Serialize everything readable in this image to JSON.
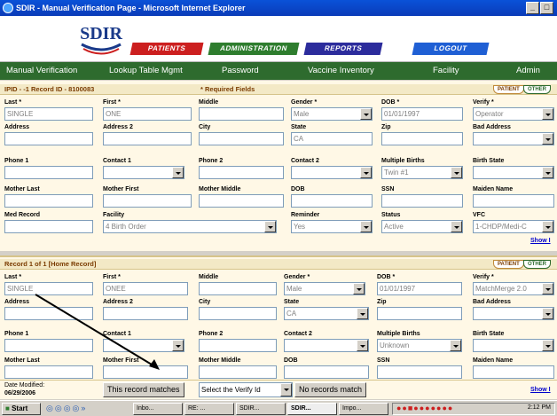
{
  "window": {
    "title": "SDIR - Manual Verification Page - Microsoft Internet Explorer",
    "min": "_",
    "restore": "□"
  },
  "banner": {
    "logo": "SDIR",
    "tabs": [
      "PATIENTS",
      "ADMINISTRATION",
      "REPORTS",
      "LOGOUT"
    ]
  },
  "menu": [
    "Manual Verification",
    "Lookup Table Mgmt",
    "Password",
    "Vaccine Inventory",
    "Facility",
    "Admin"
  ],
  "colors": {
    "tab_patients": "#cc1f1f",
    "tab_admin": "#2e7d2e",
    "tab_reports": "#2c2c9c",
    "tab_logout": "#1f5fd4",
    "menubar": "#2e6b2e"
  },
  "section1": {
    "header": "IPID - -1 Record ID - 8100083",
    "required": "* Required Fields",
    "pills": [
      "PATIENT",
      "OTHER"
    ],
    "labels": {
      "last": "Last *",
      "first": "First *",
      "middle": "Middle",
      "gender": "Gender *",
      "dob": "DOB *",
      "verify": "Verify *",
      "address": "Address",
      "address2": "Address 2",
      "city": "City",
      "state": "State",
      "zip": "Zip",
      "bad_address": "Bad Address",
      "phone1": "Phone 1",
      "contact1": "Contact 1",
      "phone2": "Phone 2",
      "contact2": "Contact 2",
      "multiple_births": "Multiple Births",
      "birth_state": "Birth State",
      "mother_last": "Mother Last",
      "mother_first": "Mother First",
      "mother_middle": "Mother Middle",
      "dob2": "DOB",
      "ssn": "SSN",
      "maiden": "Maiden Name",
      "med_record": "Med Record",
      "facility": "Facility",
      "reminder": "Reminder",
      "status": "Status",
      "vfc": "VFC"
    },
    "values": {
      "last": "SINGLE",
      "first": "ONE",
      "gender": "Male",
      "dob": "01/01/1997",
      "verify": "Operator",
      "state": "CA",
      "multiple_births": "Twin #1",
      "facility": "4 Birth Order",
      "reminder": "Yes",
      "status": "Active",
      "vfc": "1-CHDP/Medi-C"
    },
    "show": "Show I"
  },
  "section2": {
    "header": "Record 1 of 1 [Home Record]",
    "pills": [
      "PATIENT",
      "OTHER"
    ],
    "labels": {
      "last": "Last *",
      "first": "First *",
      "middle": "Middle",
      "gender": "Gender *",
      "dob": "DOB *",
      "verify": "Verify *",
      "address": "Address",
      "address2": "Address 2",
      "city": "City",
      "state": "State",
      "zip": "Zip",
      "bad_address": "Bad Address",
      "phone1": "Phone 1",
      "contact1": "Contact 1",
      "phone2": "Phone 2",
      "contact2": "Contact 2",
      "multiple_births": "Multiple Births",
      "birth_state": "Birth State",
      "mother_last": "Mother Last",
      "mother_first": "Mother First",
      "mother_middle": "Mother Middle",
      "dob2": "DOB",
      "ssn": "SSN",
      "maiden": "Maiden Name"
    },
    "values": {
      "last": "SINGLE",
      "first": "ONEE",
      "gender": "Male",
      "dob": "01/01/1997",
      "verify": "MatchMerge 2.0",
      "state": "CA",
      "multiple_births": "Unknown"
    }
  },
  "bottom": {
    "modified_label": "Date Modified:",
    "modified_date": "06/29/2006",
    "btn_match": "This record matches",
    "select_verify": "Select the Verify Id",
    "btn_nomatch": "No records match",
    "show": "Show I"
  },
  "taskbar": {
    "start": "Start",
    "items": [
      "Inbo...",
      "RE: ...",
      "SDIR...",
      "SDIR...",
      "Impo..."
    ],
    "clock": "2:12 PM"
  }
}
